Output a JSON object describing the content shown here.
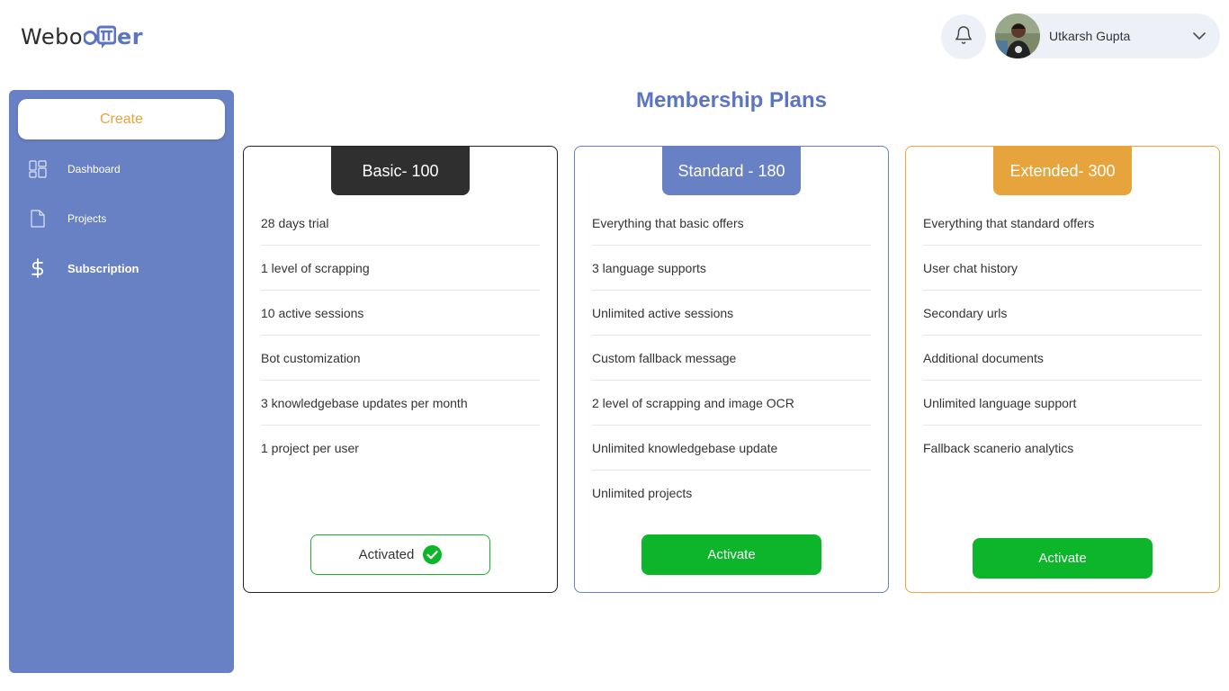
{
  "header": {
    "logo": {
      "prefix": "Webo",
      "suffix": "er",
      "mark_icon": "chat-bubble-tt-icon"
    },
    "notification_icon": "bell-icon",
    "user": {
      "name": "Utkarsh Gupta",
      "avatar_icon": "avatar-photo",
      "dropdown_icon": "chevron-down-icon"
    }
  },
  "sidebar": {
    "create_label": "Create",
    "items": [
      {
        "label": "Dashboard",
        "icon": "dashboard-grid-icon",
        "active": false
      },
      {
        "label": "Projects",
        "icon": "file-icon",
        "active": false
      },
      {
        "label": "Subscription",
        "icon": "dollar-icon",
        "active": true
      }
    ]
  },
  "main": {
    "title": "Membership Plans",
    "plans": [
      {
        "name": "Basic- 100",
        "features": [
          "28 days trial",
          "1 level of scrapping",
          "10 active sessions",
          "Bot customization",
          "3 knowledgebase updates per month",
          "1 project per user"
        ],
        "button_label": "Activated",
        "status": "activated"
      },
      {
        "name": "Standard - 180",
        "features": [
          "Everything that basic offers",
          "3 language supports",
          "Unlimited active sessions",
          "Custom fallback message",
          "2 level of scrapping and image OCR",
          "Unlimited knowledgebase update",
          "Unlimited projects"
        ],
        "button_label": "Activate",
        "status": "available"
      },
      {
        "name": "Extended- 300",
        "features": [
          "Everything that standard offers",
          "User chat history",
          "Secondary urls",
          "Additional documents",
          "Unlimited language support",
          "Fallback scanerio analytics"
        ],
        "button_label": "Activate",
        "status": "available"
      }
    ]
  },
  "colors": {
    "brand_blue": "#6880c4",
    "accent_orange": "#e8a43c",
    "dark": "#2f2f2f",
    "success_green": "#0cb52a"
  }
}
